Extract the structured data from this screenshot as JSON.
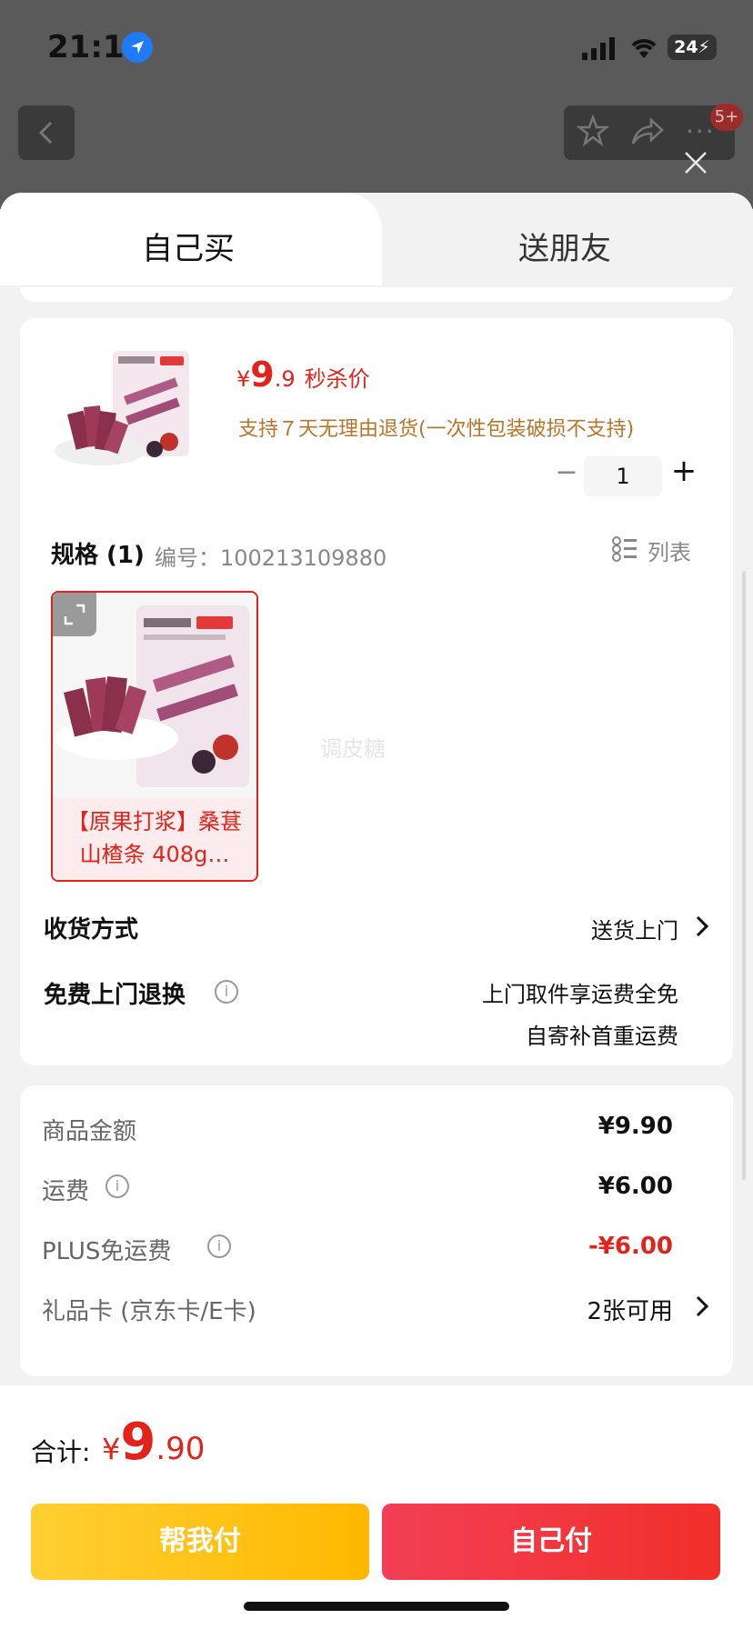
{
  "status_bar": {
    "time": "21:11",
    "battery": "24"
  },
  "nav": {
    "badge": "5+"
  },
  "tabs": [
    {
      "label": "自己买"
    },
    {
      "label": "送朋友"
    }
  ],
  "product": {
    "price_currency": "¥",
    "price_int": "9",
    "price_dec": ".9",
    "price_tag": "秒杀价",
    "return_note": "支持７天无理由退货(一次性包装破损不支持)",
    "quantity": "1"
  },
  "spec": {
    "title": "规格 (1)",
    "code": "编号：100213109880",
    "list_label": "列表",
    "sku_label": "【原果打浆】桑葚山楂条 408g…",
    "watermark": "调皮糖"
  },
  "delivery": {
    "label": "收货方式",
    "value": "送货上门"
  },
  "returns": {
    "label": "免费上门退换",
    "line1": "上门取件享运费全免",
    "line2": "自寄补首重运费"
  },
  "fees": [
    {
      "label": "商品金额",
      "value": "¥9.90"
    },
    {
      "label": "运费",
      "value": "¥6.00"
    },
    {
      "label": "PLUS免运费",
      "value": "-¥6.00"
    },
    {
      "label": "礼品卡 (京东卡/E卡)",
      "value": "2张可用"
    }
  ],
  "footer": {
    "total_label": "合计:",
    "total_currency": "¥",
    "total_int": "9",
    "total_dec": ".90",
    "help_pay": "帮我付",
    "self_pay": "自己付"
  },
  "colors": {
    "accent_red": "#e2231a",
    "return_note": "#b8752a",
    "help_button": "#ffc21a"
  }
}
